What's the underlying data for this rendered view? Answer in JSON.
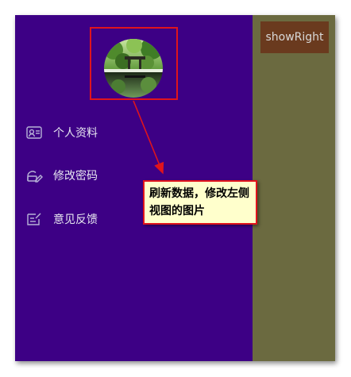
{
  "drawer": {
    "background": "#3d0085",
    "menu_items": [
      {
        "label": "个人资料",
        "icon": "profile-card-icon"
      },
      {
        "label": "修改密码",
        "icon": "edit-password-icon"
      },
      {
        "label": "意见反馈",
        "icon": "feedback-icon"
      }
    ],
    "avatar": {
      "icon": "avatar-photo"
    }
  },
  "main": {
    "background": "#6b6a40",
    "show_right_label": "showRight"
  },
  "annotation": {
    "text": "刷新数据，修改左侧视图的图片",
    "border_color": "#e0141c",
    "background": "#ffffcc"
  }
}
